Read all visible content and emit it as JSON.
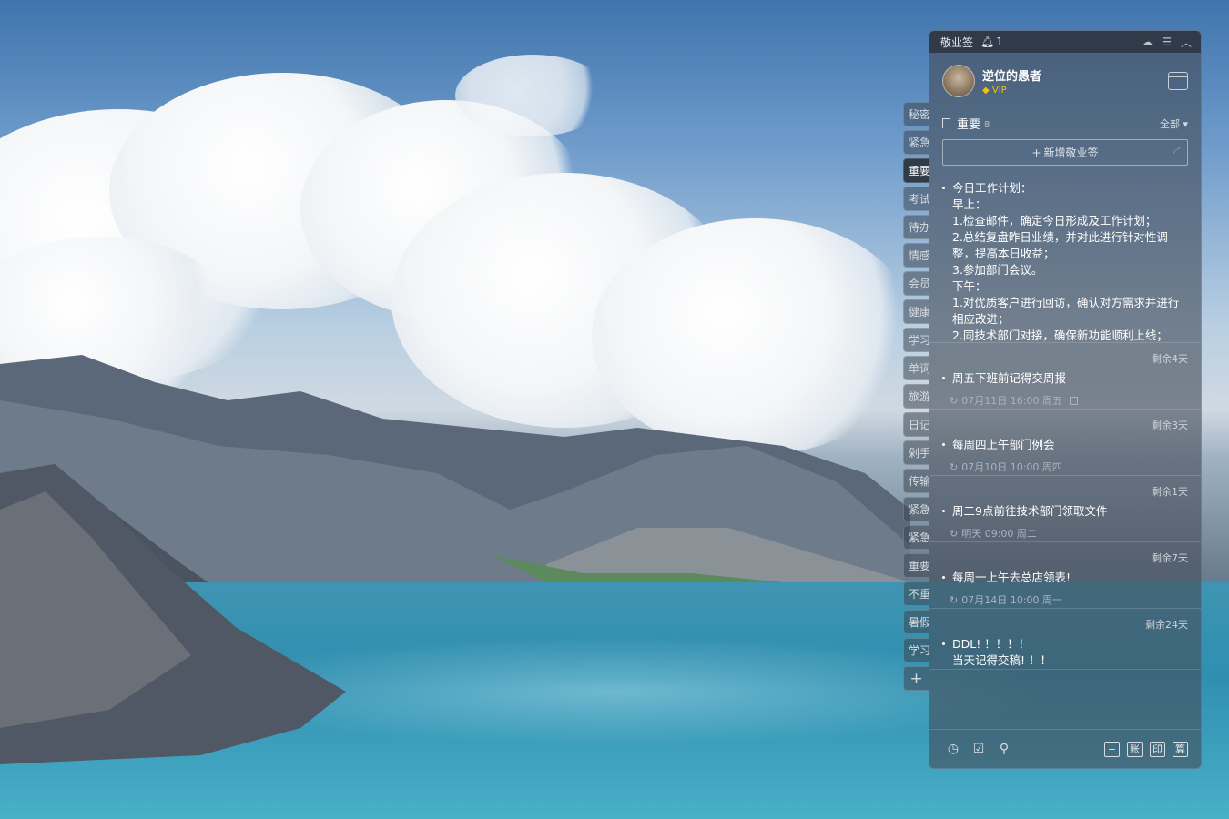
{
  "titlebar": {
    "app_name": "敬业签",
    "notification_count": "1",
    "icons": [
      "bell-icon",
      "cloud-icon",
      "menu-icon",
      "collapse-icon"
    ]
  },
  "user": {
    "name": "逆位的愚者",
    "badge": "VIP"
  },
  "section": {
    "title": "重要",
    "count": "8",
    "filter": "全部"
  },
  "add_button": {
    "label": "新增敬业签"
  },
  "tabs": [
    {
      "label": "秘密"
    },
    {
      "label": "紧急"
    },
    {
      "label": "重要"
    },
    {
      "label": "考试"
    },
    {
      "label": "待办"
    },
    {
      "label": "情感"
    },
    {
      "label": "会员"
    },
    {
      "label": "健康"
    },
    {
      "label": "学习"
    },
    {
      "label": "单词"
    },
    {
      "label": "旅游"
    },
    {
      "label": "日记"
    },
    {
      "label": "剁手"
    },
    {
      "label": "传输"
    },
    {
      "label": "紧急"
    },
    {
      "label": "紧急"
    },
    {
      "label": "重要"
    },
    {
      "label": "不重"
    },
    {
      "label": "暑假"
    },
    {
      "label": "学习"
    },
    {
      "label": "+"
    }
  ],
  "notes": [
    {
      "remaining": "",
      "text": "今日工作计划：\n早上：\n1.检查邮件，确定今日形成及工作计划；\n2.总结复盘昨日业绩，并对此进行针对性调整，提高本日收益；\n3.参加部门会议。\n下午：\n1.对优质客户进行回访，确认对方需求并进行相应改进；\n2.同技术部门对接，确保新功能顺利上线；",
      "meta": ""
    },
    {
      "remaining": "剩余4天",
      "text": "周五下班前记得交周报",
      "meta": "07月11日 16:00 周五"
    },
    {
      "remaining": "剩余3天",
      "text": "每周四上午部门例会",
      "meta": "07月10日 10:00 周四"
    },
    {
      "remaining": "剩余1天",
      "text": "周二9点前往技术部门领取文件",
      "meta": "明天 09:00 周二"
    },
    {
      "remaining": "剩余7天",
      "text": "每周一上午去总店领表!",
      "meta": "07月14日 10:00 周一"
    },
    {
      "remaining": "剩余24天",
      "text": "DDL! ！！！！\n当天记得交稿! ！！",
      "meta": ""
    }
  ],
  "footer": {
    "right_buttons": [
      "+",
      "账",
      "印",
      "算"
    ]
  }
}
